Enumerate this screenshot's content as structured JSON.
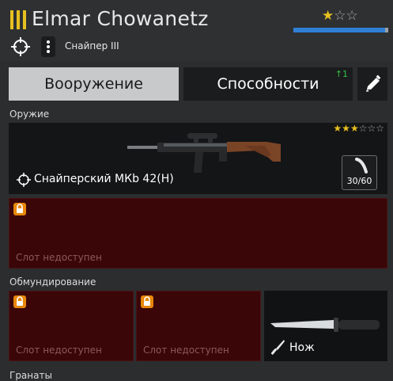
{
  "soldier": {
    "name": "Elmar Chowanetz",
    "role": "Снайпер III",
    "rank_icon": "three-bars-rank-icon",
    "stars_filled": 1,
    "stars_total": 3,
    "xp_fraction": 0.97
  },
  "tabs": {
    "weapons": "Вооружение",
    "abilities": "Способности",
    "abilities_badge": "↑1",
    "edit_icon": "pencil-icon"
  },
  "sections": {
    "weapon": "Оружие",
    "uniform": "Обмундирование",
    "grenades": "Гранаты"
  },
  "weapon": {
    "name": "Снайперский МКb 42(H)",
    "ammo": "30/60",
    "stars_filled": 3,
    "stars_total": 6
  },
  "locked_slot_text": "Слот недоступен",
  "knife": {
    "name": "Нож"
  },
  "colors": {
    "accent_gold": "#e6c020",
    "xp_blue": "#2f7fd4",
    "locked_red": "#3a0608",
    "lock_orange": "#e8870a"
  }
}
